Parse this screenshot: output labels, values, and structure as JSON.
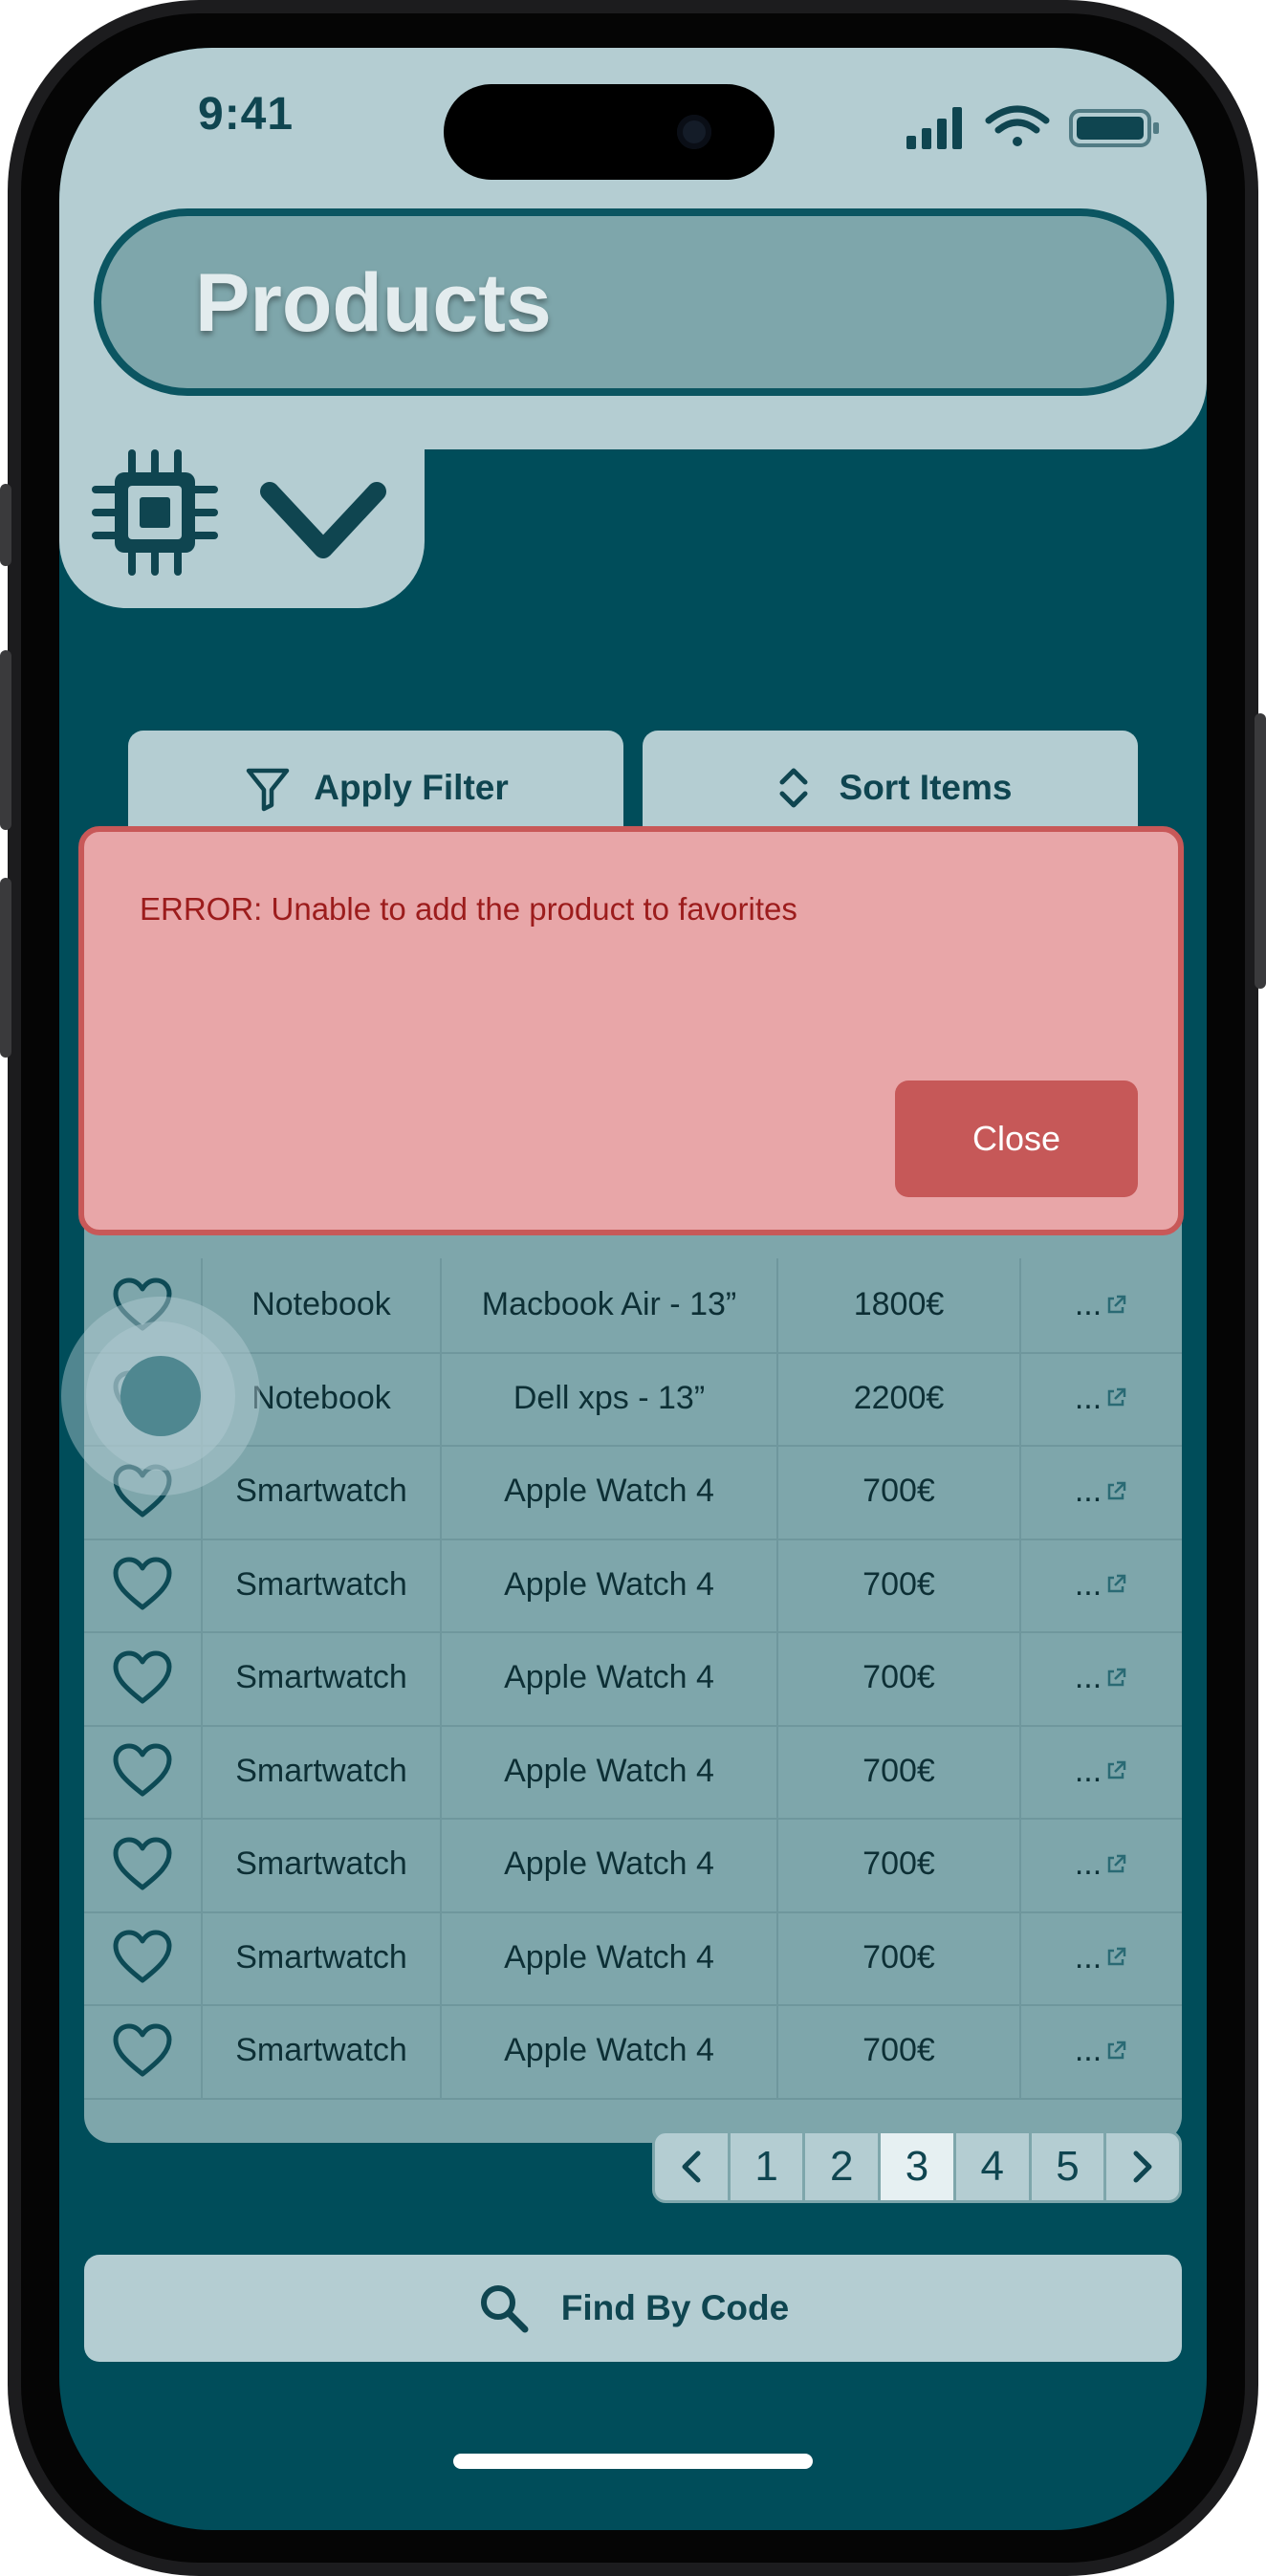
{
  "status_bar": {
    "time": "9:41"
  },
  "header": {
    "title": "Products",
    "chip_icon": "cpu-chip-icon",
    "toggle_icon": "chevron-down-icon"
  },
  "toolbar": {
    "filter_label": "Apply Filter",
    "filter_icon": "funnel-icon",
    "sort_label": "Sort Items",
    "sort_icon": "sort-arrows-icon"
  },
  "error": {
    "message": "ERROR: Unable to add the product to favorites",
    "close_label": "Close"
  },
  "table": {
    "rows": [
      {
        "category": "Notebook",
        "name": "Macbook Air - 13”",
        "price": "1800€",
        "more": "..."
      },
      {
        "category": "Notebook",
        "name": "Dell xps - 13”",
        "price": "2200€",
        "more": "..."
      },
      {
        "category": "Smartwatch",
        "name": "Apple Watch 4",
        "price": "700€",
        "more": "..."
      },
      {
        "category": "Smartwatch",
        "name": "Apple Watch 4",
        "price": "700€",
        "more": "..."
      },
      {
        "category": "Smartwatch",
        "name": "Apple Watch 4",
        "price": "700€",
        "more": "..."
      },
      {
        "category": "Smartwatch",
        "name": "Apple Watch 4",
        "price": "700€",
        "more": "..."
      },
      {
        "category": "Smartwatch",
        "name": "Apple Watch 4",
        "price": "700€",
        "more": "..."
      },
      {
        "category": "Smartwatch",
        "name": "Apple Watch 4",
        "price": "700€",
        "more": "..."
      },
      {
        "category": "Smartwatch",
        "name": "Apple Watch 4",
        "price": "700€",
        "more": "..."
      }
    ]
  },
  "pagination": {
    "pages": [
      "1",
      "2",
      "3",
      "4",
      "5"
    ],
    "current": "3"
  },
  "find": {
    "label": "Find By Code",
    "icon": "search-icon"
  },
  "colors": {
    "background": "#004d5a",
    "surface": "#b4cdd2",
    "table": "#7ea6ab",
    "error_bg": "#e8a6a8",
    "error_border": "#c85858",
    "error_text": "#9c1c1c"
  }
}
